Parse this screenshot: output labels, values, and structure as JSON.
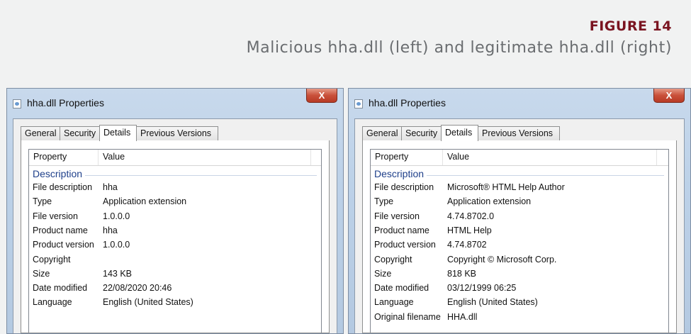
{
  "figure": {
    "number": "FIGURE 14",
    "caption": "Malicious hha.dll (left) and legitimate hha.dll (right)"
  },
  "colors": {
    "figure_number": "#7a1420",
    "caption": "#6a6d70",
    "group_label": "#1e3f8a",
    "close_button": "#c9503a"
  },
  "left_window": {
    "title": "hha.dll Properties",
    "close_label": "X",
    "tabs": [
      "General",
      "Security",
      "Details",
      "Previous Versions"
    ],
    "active_tab": "Details",
    "columns": {
      "property": "Property",
      "value": "Value"
    },
    "group": "Description",
    "rows": [
      {
        "property": "File description",
        "value": "hha"
      },
      {
        "property": "Type",
        "value": "Application extension"
      },
      {
        "property": "File version",
        "value": "1.0.0.0"
      },
      {
        "property": "Product name",
        "value": "hha"
      },
      {
        "property": "Product version",
        "value": "1.0.0.0"
      },
      {
        "property": "Copyright",
        "value": ""
      },
      {
        "property": "Size",
        "value": "143 KB"
      },
      {
        "property": "Date modified",
        "value": "22/08/2020 20:46"
      },
      {
        "property": "Language",
        "value": "English (United States)"
      }
    ]
  },
  "right_window": {
    "title": "hha.dll Properties",
    "close_label": "X",
    "tabs": [
      "General",
      "Security",
      "Details",
      "Previous Versions"
    ],
    "active_tab": "Details",
    "columns": {
      "property": "Property",
      "value": "Value"
    },
    "group": "Description",
    "rows": [
      {
        "property": "File description",
        "value": "Microsoft® HTML Help Author"
      },
      {
        "property": "Type",
        "value": "Application extension"
      },
      {
        "property": "File version",
        "value": "4.74.8702.0"
      },
      {
        "property": "Product name",
        "value": "HTML Help"
      },
      {
        "property": "Product version",
        "value": "4.74.8702"
      },
      {
        "property": "Copyright",
        "value": "Copyright © Microsoft Corp."
      },
      {
        "property": "Size",
        "value": "818 KB"
      },
      {
        "property": "Date modified",
        "value": "03/12/1999 06:25"
      },
      {
        "property": "Language",
        "value": "English (United States)"
      },
      {
        "property": "Original filename",
        "value": "HHA.dll"
      }
    ]
  }
}
